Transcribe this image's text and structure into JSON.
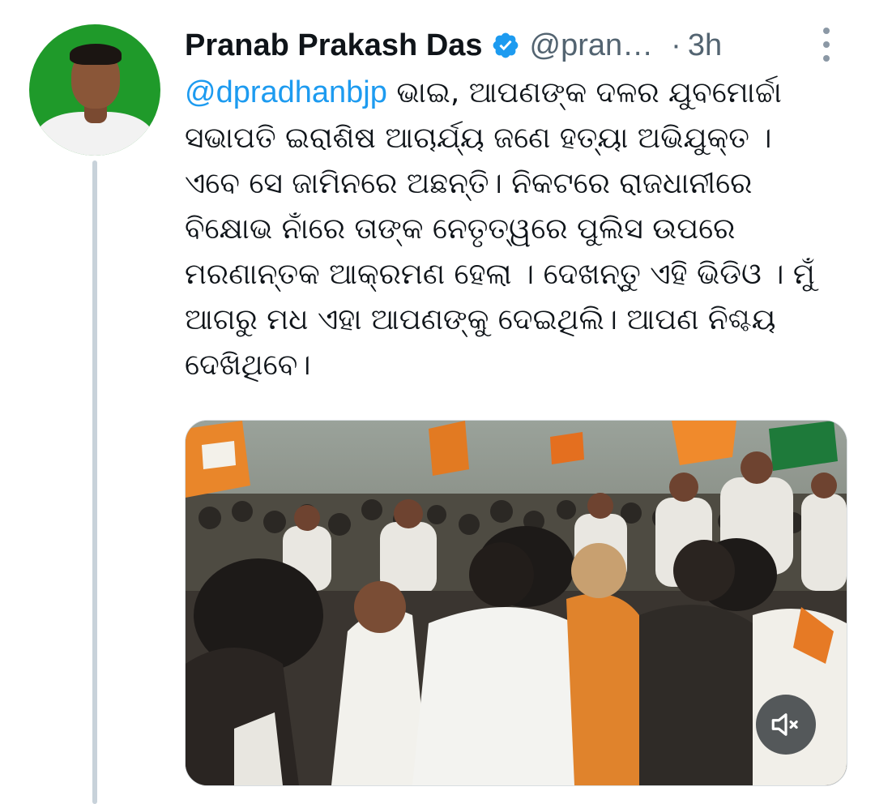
{
  "author": {
    "name": "Pranab Prakash Das",
    "handle": "@pran…",
    "separator": "·",
    "time": "3h",
    "verified": true,
    "avatar_bg": "#1f9a2a"
  },
  "tweet": {
    "mention": "@dpradhanbjp",
    "text": " ଭାଇ, ଆପଣଙ୍କ ଦଳର ଯୁବମୋର୍ଚ୍ଚା ସଭାପତି ଇରାଶିଷ ଆଚାର୍ଯ୍ୟ ଜଣେ ହତ୍ୟା ଅଭିଯୁକ୍ତ । ଏବେ ସେ ଜାମିନରେ ଅଛନ୍ତି। ନିକଟରେ ରାଜଧାନୀରେ ବିକ୍ଷୋଭ ନାଁରେ ତାଙ୍କ ନେତୃତ୍ୱରେ ପୁଲିସ ଉପରେ ମରଣାନ୍ତକ ଆକ୍ରମଣ ହେଲା । ଦେଖନ୍ତୁ ଏହି ଭିଡିଓ । ମୁଁ ଆଗରୁ ମଧ ଏହା ଆପଣଙ୍କୁ ଦେଇଥିଲି। ଆପଣ ନିଶ୍ଚୟ ଦେଖିଥିବେ।"
  },
  "media": {
    "type": "video",
    "muted": true
  },
  "icons": {
    "verified": "verified-badge-icon",
    "more": "more-vertical-icon",
    "mute": "speaker-muted-icon"
  },
  "colors": {
    "link": "#1d9bf0",
    "secondary_text": "#536471",
    "verified": "#1d9bf0",
    "thread_line": "#c8d2da"
  }
}
